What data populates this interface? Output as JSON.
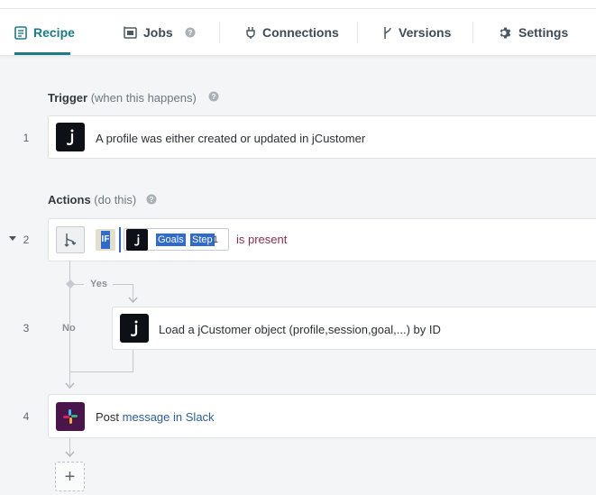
{
  "tabs": [
    {
      "label": "Recipe",
      "icon": "recipe-icon",
      "active": true
    },
    {
      "label": "Jobs",
      "icon": "jobs-icon",
      "active": false
    },
    {
      "label": "Connections",
      "icon": "plug-icon",
      "active": false
    },
    {
      "label": "Versions",
      "icon": "branch-icon",
      "active": false
    },
    {
      "label": "Settings",
      "icon": "gear-icon",
      "active": false
    }
  ],
  "trigger": {
    "title": "Trigger",
    "subtitle": "(when this happens)",
    "step_number": "1",
    "text": "A profile was either created or updated in jCustomer"
  },
  "actions": {
    "title": "Actions",
    "subtitle": "(do this)"
  },
  "condition_step": {
    "step_number": "2",
    "if_label": "IF",
    "app_letter": "j",
    "pill_goals": "Goals",
    "pill_step": "Step",
    "pill_num": "1",
    "operator": "is present",
    "yes_label": "Yes",
    "no_label": "No"
  },
  "load_step": {
    "step_number": "3",
    "text": "Load a jCustomer object (profile,session,goal,...) by ID"
  },
  "slack_step": {
    "step_number": "4",
    "verb": "Post",
    "object": "message",
    "prep": "in",
    "app": "Slack"
  },
  "add_step": {
    "label": "+"
  },
  "app_icon_letter": "j",
  "colors": {
    "accent": "#1b7b86",
    "link": "#2b5e9b",
    "operator": "#8c2c4d",
    "jcustomer_bg": "#0d1117",
    "slack_bg": "#4a154b"
  }
}
